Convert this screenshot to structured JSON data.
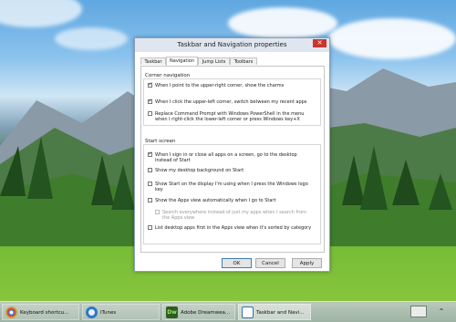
{
  "dialog": {
    "title": "Taskbar and Navigation properties",
    "close_glyph": "✕",
    "tabs": [
      {
        "label": "Taskbar",
        "active": false
      },
      {
        "label": "Navigation",
        "active": true
      },
      {
        "label": "Jump Lists",
        "active": false
      },
      {
        "label": "Toolbars",
        "active": false
      }
    ],
    "corner_navigation": {
      "title": "Corner navigation",
      "options": [
        {
          "label": "When I point to the upper-right corner, show the charms",
          "checked": true
        },
        {
          "label": "When I click the upper-left corner, switch between my recent apps",
          "checked": true
        },
        {
          "label": "Replace Command Prompt with Windows PowerShell in the menu when I right-click the lower-left corner or press Windows key+X",
          "checked": false
        }
      ]
    },
    "start_screen": {
      "title": "Start screen",
      "options": [
        {
          "label": "When I sign in or close all apps on a screen, go to the desktop instead of Start",
          "checked": true,
          "enabled": true
        },
        {
          "label": "Show my desktop background on Start",
          "checked": false,
          "enabled": true
        },
        {
          "label": "Show Start on the display I'm using when I press the Windows logo key",
          "checked": false,
          "enabled": true
        },
        {
          "label": "Show the Apps view automatically when I go to Start",
          "checked": false,
          "enabled": true
        },
        {
          "label": "Search everywhere instead of just my apps when I search from the Apps view",
          "checked": false,
          "enabled": false
        },
        {
          "label": "List desktop apps first in the Apps view when it's sorted by category",
          "checked": false,
          "enabled": true
        }
      ]
    },
    "buttons": {
      "ok": "OK",
      "cancel": "Cancel",
      "apply": "Apply"
    }
  },
  "taskbar": {
    "items": [
      {
        "label": "Keyboard shortcu...",
        "icon": "chrome-icon",
        "color": "#4a9a3a",
        "active": false
      },
      {
        "label": "iTunes",
        "icon": "itunes-icon",
        "color": "#2f77c9",
        "active": false
      },
      {
        "label": "Adobe Dreamwea...",
        "icon": "dreamweaver-icon",
        "icon_text": "Dw",
        "color": "#2d5e1e",
        "active": false
      },
      {
        "label": "Taskbar and Navi...",
        "icon": "settings-window-icon",
        "color": "#3a6ea5",
        "active": true
      }
    ],
    "tray_icons": [
      "keyboard-icon",
      "chevron-up-icon"
    ]
  }
}
